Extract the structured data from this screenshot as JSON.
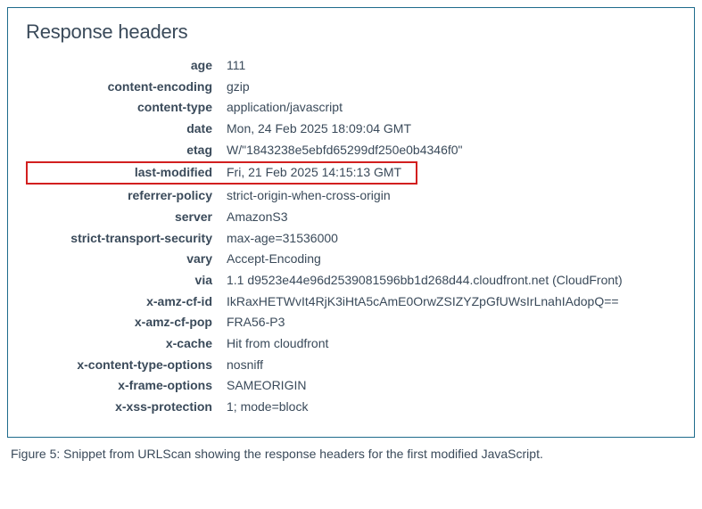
{
  "panel": {
    "title": "Response headers",
    "headers": [
      {
        "key": "age",
        "value": "111",
        "highlighted": false
      },
      {
        "key": "content-encoding",
        "value": "gzip",
        "highlighted": false
      },
      {
        "key": "content-type",
        "value": "application/javascript",
        "highlighted": false
      },
      {
        "key": "date",
        "value": "Mon, 24 Feb 2025 18:09:04 GMT",
        "highlighted": false
      },
      {
        "key": "etag",
        "value": "W/\"1843238e5ebfd65299df250e0b4346f0\"",
        "highlighted": false
      },
      {
        "key": "last-modified",
        "value": "Fri, 21 Feb 2025 14:15:13 GMT",
        "highlighted": true
      },
      {
        "key": "referrer-policy",
        "value": "strict-origin-when-cross-origin",
        "highlighted": false
      },
      {
        "key": "server",
        "value": "AmazonS3",
        "highlighted": false
      },
      {
        "key": "strict-transport-security",
        "value": "max-age=31536000",
        "highlighted": false
      },
      {
        "key": "vary",
        "value": "Accept-Encoding",
        "highlighted": false
      },
      {
        "key": "via",
        "value": "1.1 d9523e44e96d2539081596bb1d268d44.cloudfront.net (CloudFront)",
        "highlighted": false
      },
      {
        "key": "x-amz-cf-id",
        "value": "IkRaxHETWvIt4RjK3iHtA5cAmE0OrwZSIZYZpGfUWsIrLnahIAdopQ==",
        "highlighted": false
      },
      {
        "key": "x-amz-cf-pop",
        "value": "FRA56-P3",
        "highlighted": false
      },
      {
        "key": "x-cache",
        "value": "Hit from cloudfront",
        "highlighted": false
      },
      {
        "key": "x-content-type-options",
        "value": "nosniff",
        "highlighted": false
      },
      {
        "key": "x-frame-options",
        "value": "SAMEORIGIN",
        "highlighted": false
      },
      {
        "key": "x-xss-protection",
        "value": "1; mode=block",
        "highlighted": false
      }
    ]
  },
  "caption": "Figure 5: Snippet from URLScan showing the response headers for the first modified JavaScript."
}
